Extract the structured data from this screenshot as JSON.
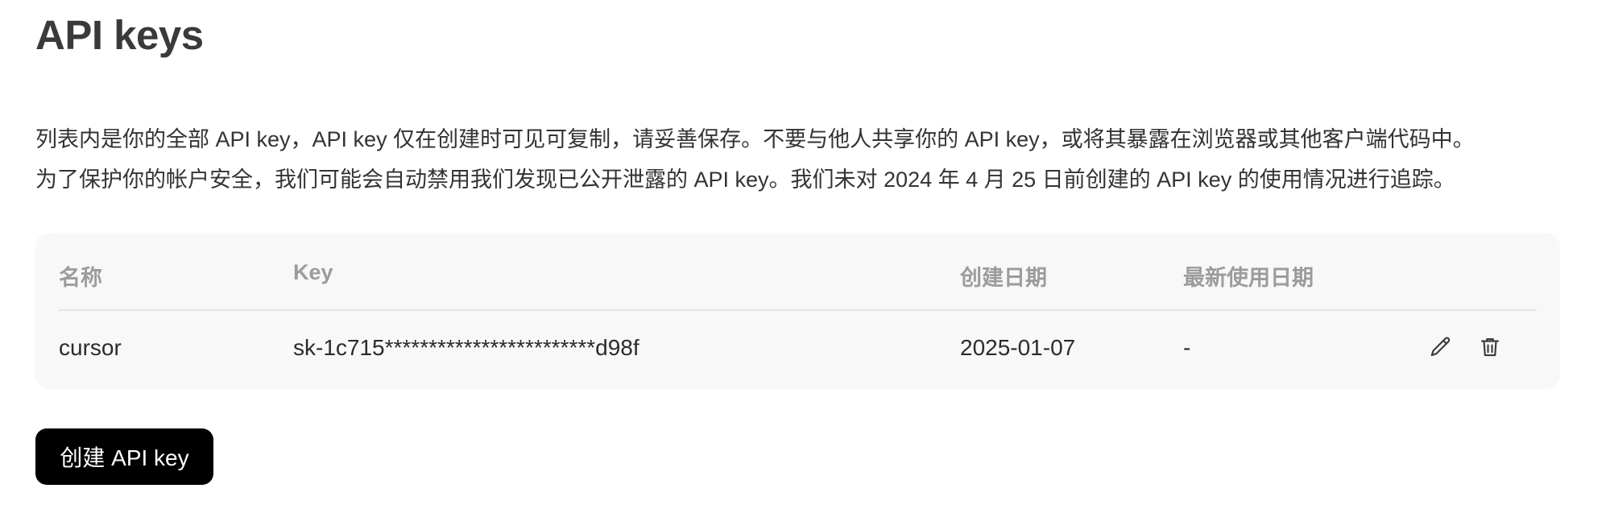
{
  "header": {
    "title": "API keys"
  },
  "description": {
    "line1": "列表内是你的全部 API key，API key 仅在创建时可见可复制，请妥善保存。不要与他人共享你的 API key，或将其暴露在浏览器或其他客户端代码中。",
    "line2": "为了保护你的帐户安全，我们可能会自动禁用我们发现已公开泄露的 API key。我们未对 2024 年 4 月 25 日前创建的 API key 的使用情况进行追踪。"
  },
  "table": {
    "columns": [
      "名称",
      "Key",
      "创建日期",
      "最新使用日期"
    ],
    "rows": [
      {
        "name": "cursor",
        "key": "sk-1c715************************d98f",
        "created": "2025-01-07",
        "last_used": "-",
        "actions": [
          "edit-icon",
          "trash-icon"
        ]
      }
    ]
  },
  "actions": {
    "create_label": "创建 API key"
  }
}
